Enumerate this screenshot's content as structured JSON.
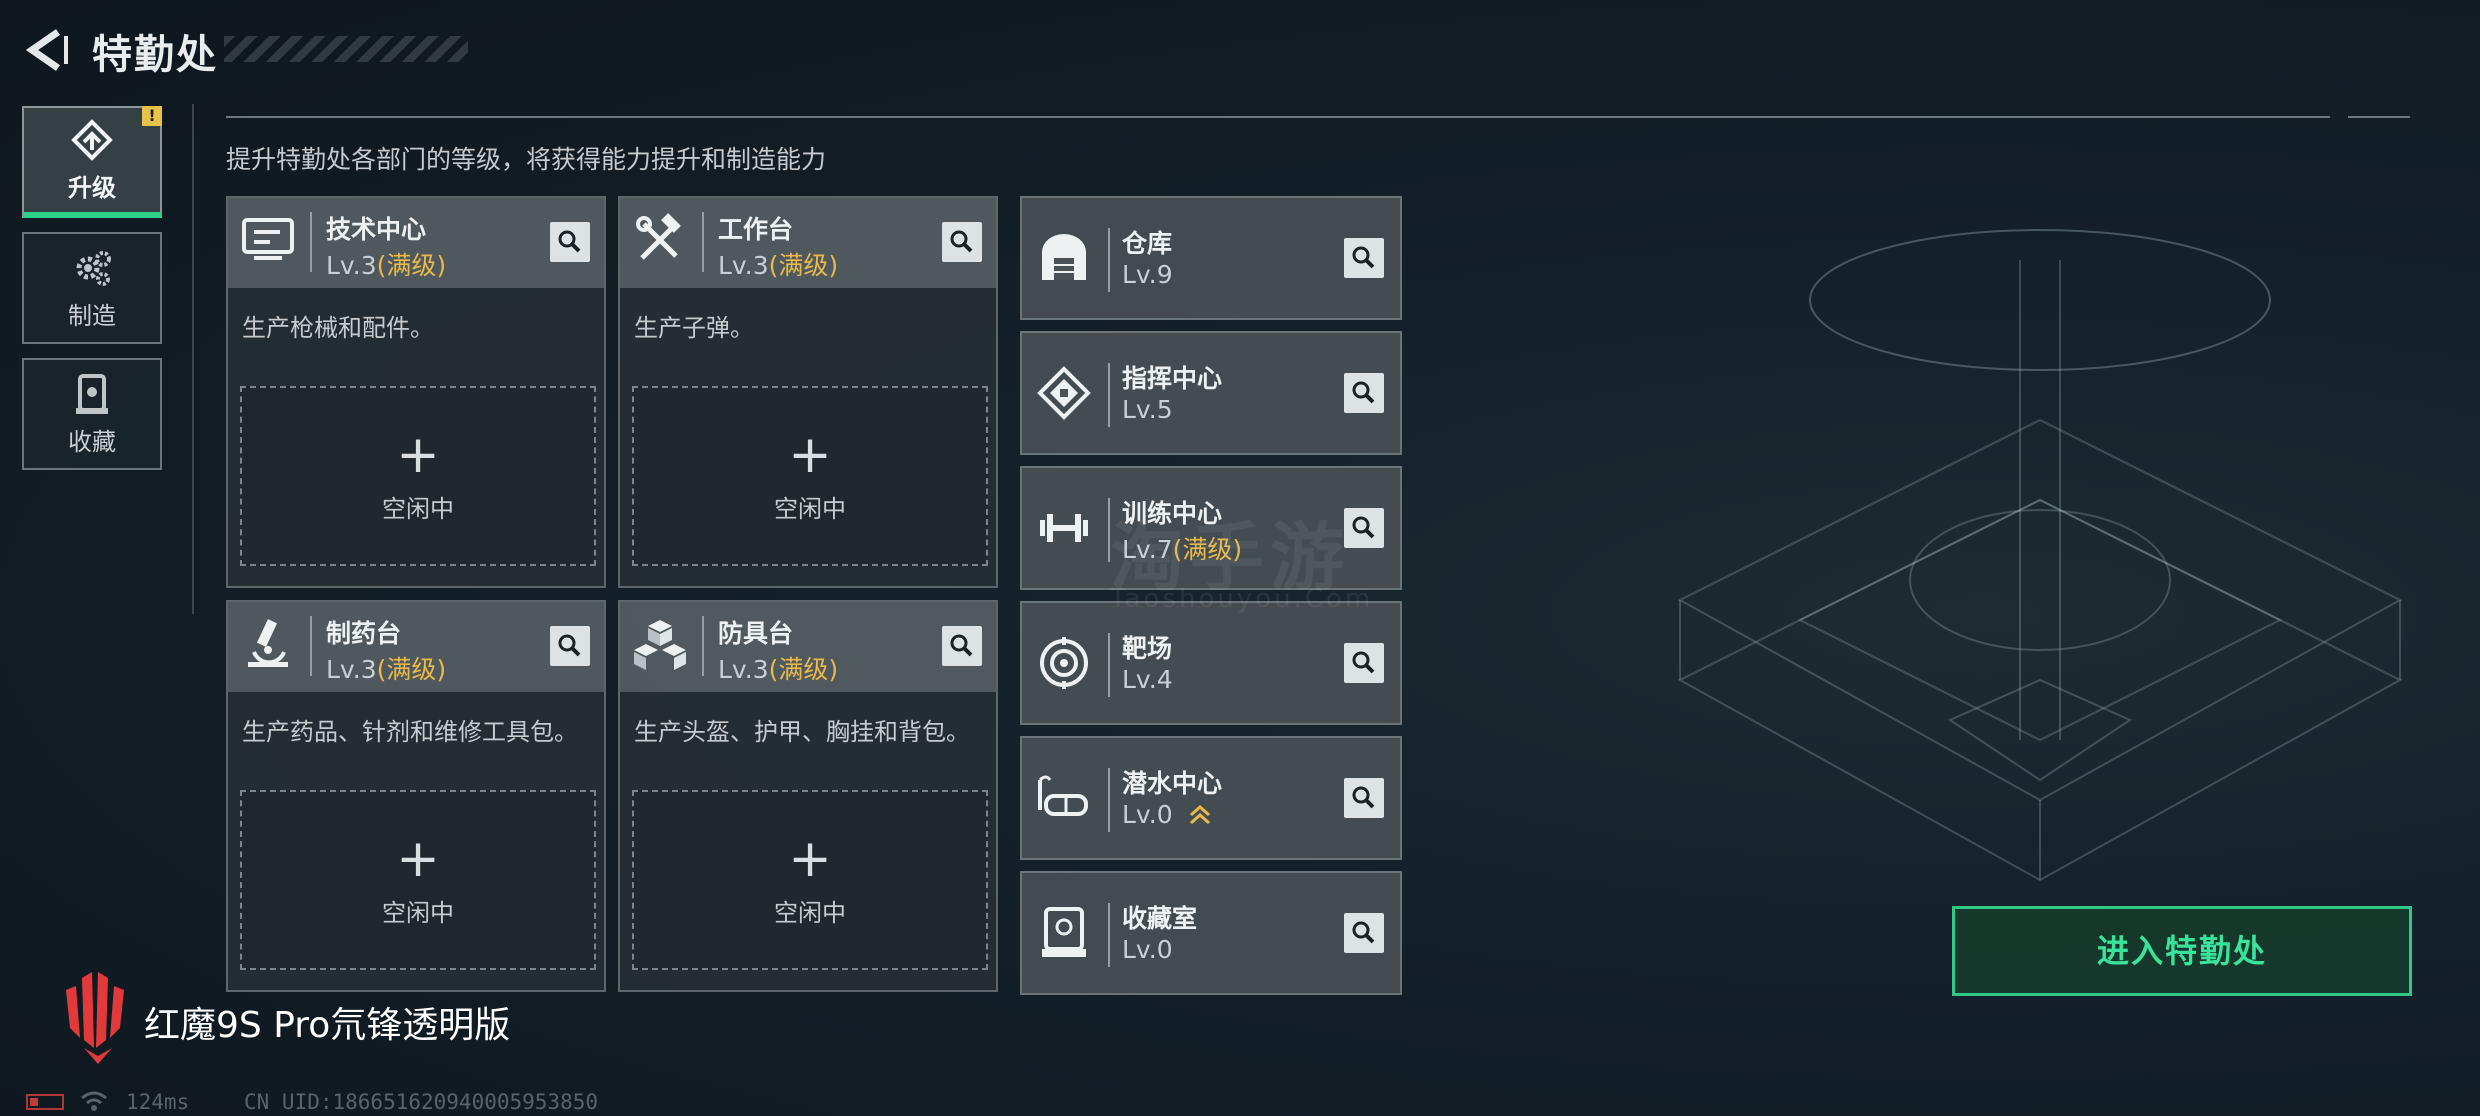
{
  "header": {
    "title": "特勤处"
  },
  "sidebar": {
    "badge": "!",
    "tabs": [
      {
        "label": "升级",
        "icon": "upgrade-icon",
        "active": true
      },
      {
        "label": "制造",
        "icon": "gears-icon",
        "active": false
      },
      {
        "label": "收藏",
        "icon": "collection-icon",
        "active": false
      }
    ]
  },
  "subtitle": "提升特勤处各部门的等级，将获得能力提升和制造能力",
  "workshops": [
    {
      "name": "技术中心",
      "level": "Lv.3",
      "status": "(满级)",
      "desc": "生产枪械和配件。",
      "slot_label": "空闲中",
      "icon": "monitor-icon"
    },
    {
      "name": "工作台",
      "level": "Lv.3",
      "status": "(满级)",
      "desc": "生产子弹。",
      "slot_label": "空闲中",
      "icon": "tools-icon"
    },
    {
      "name": "制药台",
      "level": "Lv.3",
      "status": "(满级)",
      "desc": "生产药品、针剂和维修工具包。",
      "slot_label": "空闲中",
      "icon": "microscope-icon"
    },
    {
      "name": "防具台",
      "level": "Lv.3",
      "status": "(满级)",
      "desc": "生产头盔、护甲、胸挂和背包。",
      "slot_label": "空闲中",
      "icon": "boxes-icon"
    }
  ],
  "facilities": [
    {
      "name": "仓库",
      "level": "Lv.9",
      "status": "",
      "icon": "warehouse-icon"
    },
    {
      "name": "指挥中心",
      "level": "Lv.5",
      "status": "",
      "icon": "chip-icon"
    },
    {
      "name": "训练中心",
      "level": "Lv.7",
      "status": "(满级)",
      "icon": "dumbbell-icon"
    },
    {
      "name": "靶场",
      "level": "Lv.4",
      "status": "",
      "icon": "target-icon"
    },
    {
      "name": "潜水中心",
      "level": "Lv.0",
      "status": "",
      "upgrade_available": true,
      "icon": "diving-mask-icon"
    },
    {
      "name": "收藏室",
      "level": "Lv.0",
      "status": "",
      "icon": "showcase-icon"
    }
  ],
  "enter_button": "进入特勤处",
  "watermark": {
    "main": "淘手游",
    "sub": "Taoshouyou.Com"
  },
  "device": {
    "brand": "红魔9S Pro氘锋透明版"
  },
  "statusbar": {
    "ping": "124ms",
    "uid": "CN UID:18665162094000595385​0"
  },
  "colors": {
    "accent_green": "#2fd18a",
    "gold": "#e9b94b",
    "badge_yellow": "#e8c34a"
  }
}
